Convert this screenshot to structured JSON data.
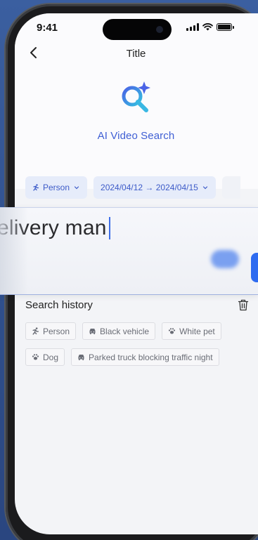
{
  "status_bar": {
    "time": "9:41"
  },
  "nav": {
    "title": "Title",
    "back_icon": "chevron-left-icon"
  },
  "app": {
    "name": "AI Video Search",
    "logo_icon": "ai-search-sparkle-icon",
    "accent": "#3f5fd4"
  },
  "filters": {
    "person_label": "Person",
    "date_range_label": "2024/04/12 → 2024/04/15"
  },
  "search": {
    "value": "elivery man"
  },
  "history": {
    "title": "Search history",
    "tags": [
      {
        "label": "Person",
        "icon": "running-person-icon"
      },
      {
        "label": "Black vehicle",
        "icon": "car-icon"
      },
      {
        "label": "White pet",
        "icon": "paw-icon"
      },
      {
        "label": "Dog",
        "icon": "paw-icon"
      },
      {
        "label": "Parked truck blocking traffic night",
        "icon": "car-icon"
      }
    ]
  }
}
